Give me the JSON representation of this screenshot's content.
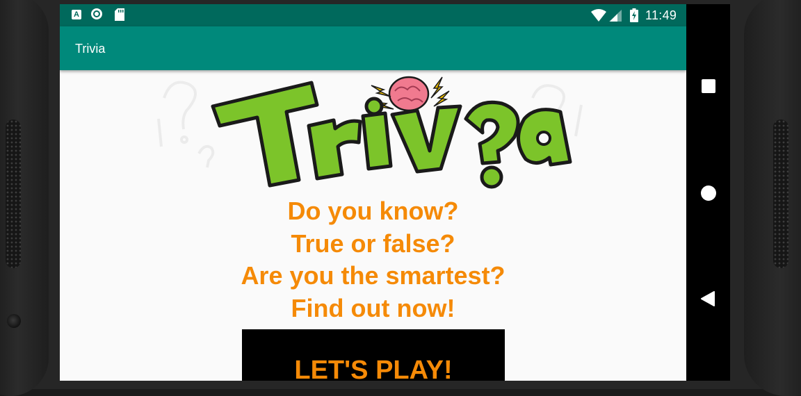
{
  "status_bar": {
    "time": "11:49",
    "icons": [
      "text-a-icon",
      "sync-circle-icon",
      "sd-card-icon",
      "wifi-icon",
      "cell-signal-icon",
      "battery-charging-icon"
    ]
  },
  "app_bar": {
    "title": "Trivia"
  },
  "logo": {
    "text": "Triv?a",
    "colors": {
      "letters": "#7cc42a",
      "outline": "#1a1a1a",
      "brain": "#f07a8f",
      "sparks": "#f5c400"
    }
  },
  "taglines": [
    "Do you know?",
    "True or false?",
    "Are you the smartest?",
    "Find out now!"
  ],
  "play_button": {
    "label": "LET'S PLAY!"
  },
  "nav_bar": {
    "items": [
      "recents-square-icon",
      "home-circle-icon",
      "back-triangle-icon"
    ]
  },
  "colors": {
    "status_bar": "#00695c",
    "app_bar": "#00897b",
    "accent_text": "#f58a07",
    "content_bg": "#fafafa",
    "button_bg": "#000000"
  }
}
